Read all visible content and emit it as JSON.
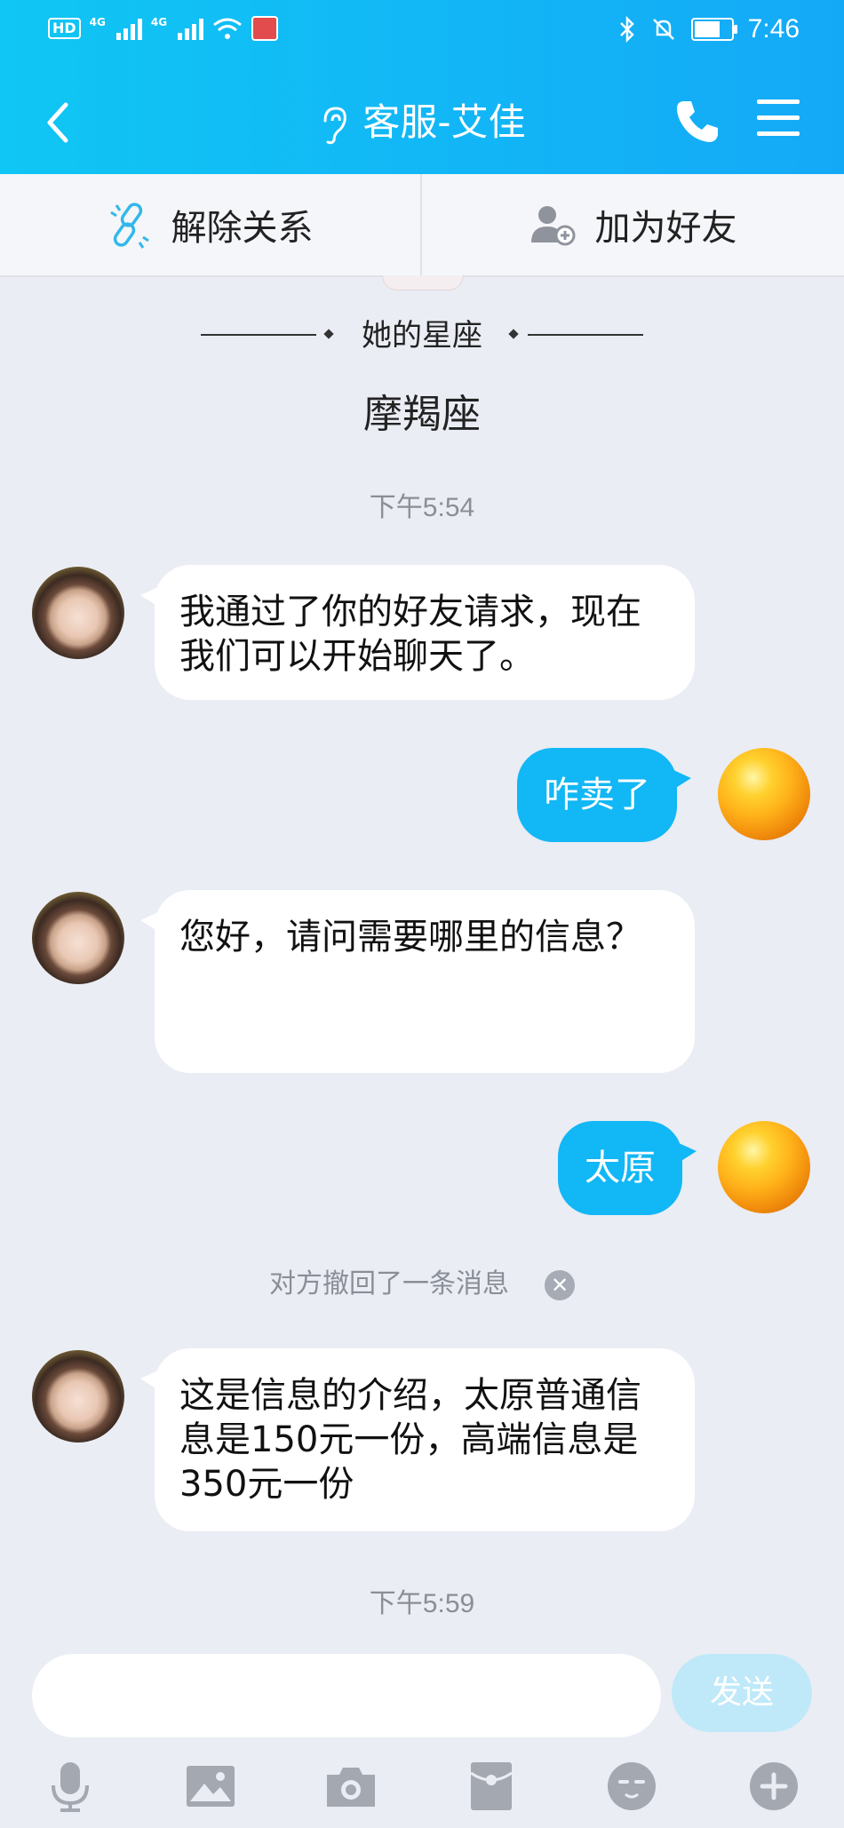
{
  "status_bar": {
    "hd_badge": "HD",
    "sim1_net": "4G",
    "sim2_net": "4G",
    "time": "7:46"
  },
  "nav": {
    "title": "客服-艾佳",
    "icons": [
      "back-icon",
      "ear-icon",
      "phone-icon",
      "menu-icon"
    ]
  },
  "actions": [
    {
      "label": "解除关系",
      "icon": "unlink-icon"
    },
    {
      "label": "加为好友",
      "icon": "add-friend-icon"
    }
  ],
  "profile": {
    "astro_label": "她的星座",
    "astro_value": "摩羯座"
  },
  "messages": {
    "ts1": "下午5:54",
    "m1": "我通过了你的好友请求，现在我们可以开始聊天了。",
    "m2": "咋卖了",
    "m3": "您好，请问需要哪里的信息？",
    "m4": "太原",
    "recall": "对方撤回了一条消息",
    "m5": "这是信息的介绍，太原普通信息是150元一份，高端信息是350元一份",
    "ts2": "下午5:59"
  },
  "composer": {
    "input_value": "",
    "send_label": "发送",
    "tools": [
      "mic-icon",
      "image-icon",
      "camera-icon",
      "red-packet-icon",
      "emoji-icon",
      "plus-icon"
    ]
  },
  "colors": {
    "header_start": "#10c6f4",
    "header_end": "#14a9f7",
    "my_bubble": "#12b7f5",
    "background": "#eaedf4"
  }
}
